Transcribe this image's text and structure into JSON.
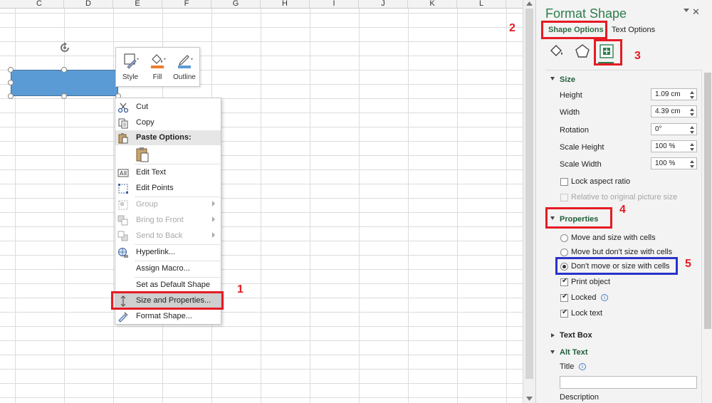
{
  "sheet": {
    "columns": [
      "C",
      "D",
      "E",
      "F",
      "G",
      "H",
      "I",
      "J",
      "K",
      "L"
    ],
    "shape_color": "#5b9bd5"
  },
  "mini_toolbar": {
    "style_label": "Style",
    "fill_label": "Fill",
    "outline_label": "Outline"
  },
  "context_menu": {
    "cut": "Cut",
    "copy": "Copy",
    "paste_options": "Paste Options:",
    "edit_text": "Edit Text",
    "edit_points": "Edit Points",
    "group": "Group",
    "bring_to_front": "Bring to Front",
    "send_to_back": "Send to Back",
    "hyperlink": "Hyperlink...",
    "assign_macro": "Assign Macro...",
    "set_default": "Set as Default Shape",
    "size_properties": "Size and Properties...",
    "format_shape": "Format Shape..."
  },
  "pane": {
    "title": "Format Shape",
    "tab_shape_options": "Shape Options",
    "tab_text_options": "Text Options",
    "size": {
      "heading": "Size",
      "height_label": "Height",
      "height_value": "1.09 cm",
      "width_label": "Width",
      "width_value": "4.39 cm",
      "rotation_label": "Rotation",
      "rotation_value": "0°",
      "scale_height_label": "Scale Height",
      "scale_height_value": "100 %",
      "scale_width_label": "Scale Width",
      "scale_width_value": "100 %",
      "lock_aspect": "Lock aspect ratio",
      "relative_original": "Relative to original picture size"
    },
    "properties": {
      "heading": "Properties",
      "move_size": "Move and size with cells",
      "move_no_size": "Move but don't size with cells",
      "dont_move": "Don't move or size with cells",
      "print_object": "Print object",
      "locked": "Locked",
      "lock_text": "Lock text"
    },
    "text_box_heading": "Text Box",
    "alt_text": {
      "heading": "Alt Text",
      "title_label": "Title",
      "description_label": "Description"
    }
  },
  "callouts": {
    "one": "1",
    "two": "2",
    "three": "3",
    "four": "4",
    "five": "5"
  },
  "colors": {
    "accent_green": "#2f7d4f",
    "annotation_red": "#e51b24",
    "annotation_blue": "#2a33c8"
  }
}
